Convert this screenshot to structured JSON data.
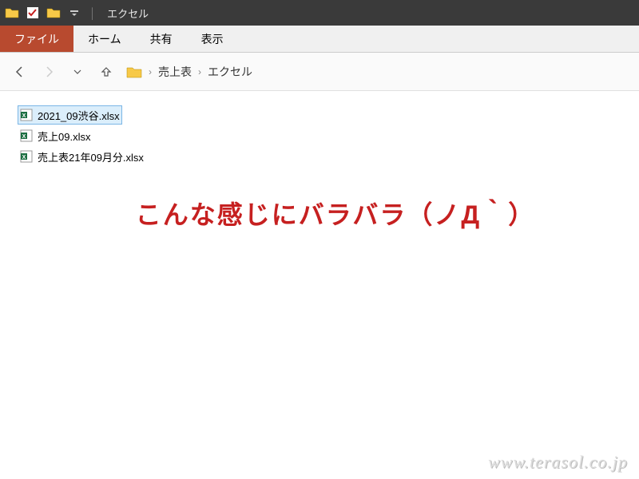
{
  "titlebar": {
    "title": "エクセル"
  },
  "tabs": {
    "file": "ファイル",
    "home": "ホーム",
    "share": "共有",
    "view": "表示"
  },
  "breadcrumb": {
    "parts": [
      "売上表",
      "エクセル"
    ]
  },
  "files": [
    {
      "name": "2021_09渋谷.xlsx",
      "selected": true
    },
    {
      "name": "売上09.xlsx",
      "selected": false
    },
    {
      "name": "売上表21年09月分.xlsx",
      "selected": false
    }
  ],
  "overlay": "こんな感じにバラバラ（ノД｀）",
  "watermark": "www.terasol.co.jp"
}
